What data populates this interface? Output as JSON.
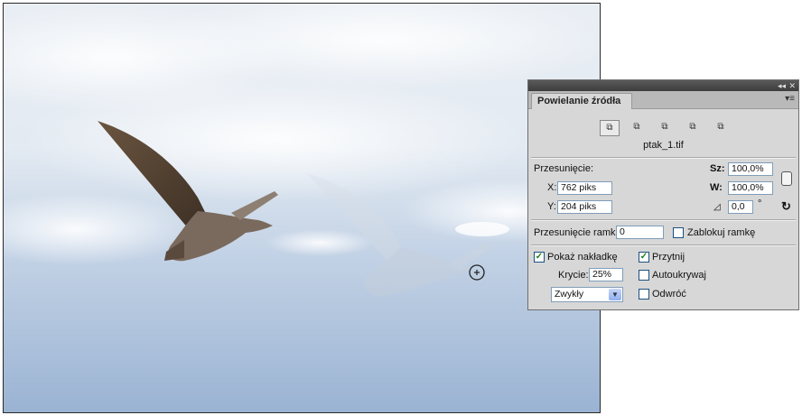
{
  "panel": {
    "tab_label": "Powielanie źródła",
    "file_name": "ptak_1.tif",
    "menu_glyph": "▾≡",
    "collapse_glyph": "◂◂",
    "close_glyph": "✕",
    "source_icons": [
      "clone-source-1-icon",
      "clone-source-2-icon",
      "clone-source-3-icon",
      "clone-source-4-icon",
      "clone-source-5-icon"
    ],
    "offset": {
      "title": "Przesunięcie:",
      "x_label": "X:",
      "x_value": "762 piks",
      "y_label": "Y:",
      "y_value": "204 piks",
      "w_label": "Sz:",
      "w_value": "100,0%",
      "h_label": "W:",
      "h_value": "100,0%",
      "angle_value": "0,0",
      "degree_symbol": "°"
    },
    "frame": {
      "label": "Przesunięcie ramki:",
      "value": "0",
      "lock_label": "Zablokuj ramkę",
      "lock_checked": false
    },
    "overlay": {
      "show_label": "Pokaż nakładkę",
      "show_checked": true,
      "clip_label": "Przytnij",
      "clip_checked": true,
      "opacity_label": "Krycie:",
      "opacity_value": "25%",
      "autohide_label": "Autoukrywaj",
      "autohide_checked": false,
      "mode_value": "Zwykły",
      "invert_label": "Odwróć",
      "invert_checked": false
    }
  },
  "colors": {
    "panel_bg": "#d7d7d7",
    "sky_top": "#eef2f6",
    "sky_bottom": "#9fb8d6",
    "checkmark": "#1d7a1d"
  }
}
